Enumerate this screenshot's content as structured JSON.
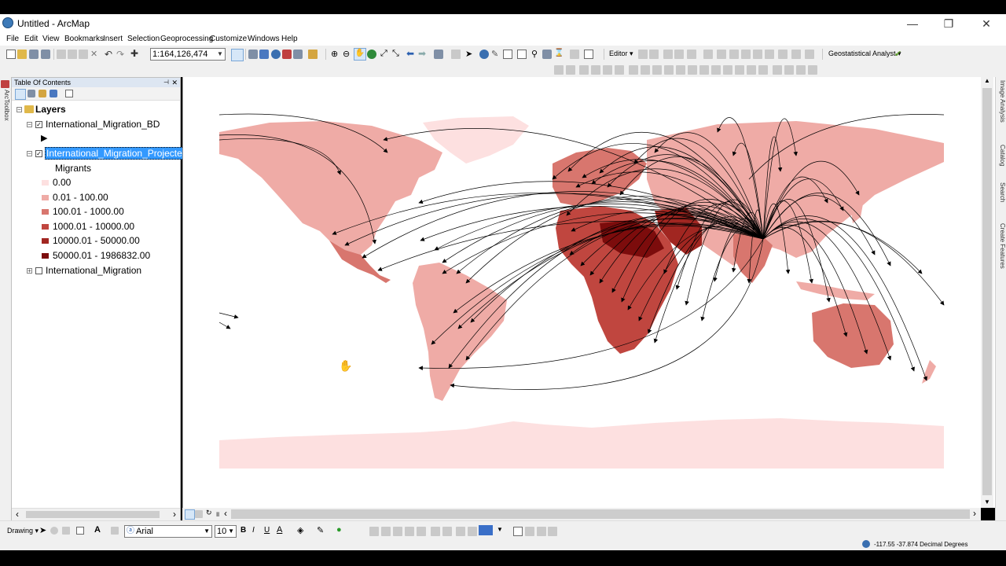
{
  "window": {
    "title": "Untitled - ArcMap",
    "controls": [
      "—",
      "❐",
      "✕"
    ]
  },
  "menu": [
    "File",
    "Edit",
    "View",
    "Bookmarks",
    "Insert",
    "Selection",
    "Geoprocessing",
    "Customize",
    "Windows",
    "Help"
  ],
  "toolbar": {
    "scale_value": "1:164,126,474",
    "editor_label": "Editor ▾",
    "geostat_label": "Geostatistical Analyst ▾"
  },
  "toc": {
    "header": "Table Of Contents",
    "root_label": "Layers",
    "layers": [
      {
        "name": "International_Migration_BD",
        "checked": true,
        "expanded": true
      },
      {
        "name": "International_Migration_Projecte",
        "checked": true,
        "expanded": true,
        "selected": true
      },
      {
        "name": "International_Migration",
        "checked": false,
        "expanded": false
      }
    ],
    "legend_title": "Migrants",
    "legend": [
      {
        "label": "0.00",
        "color": "#fde0e0"
      },
      {
        "label": "0.01 - 100.00",
        "color": "#efaba6"
      },
      {
        "label": "100.01 - 1000.00",
        "color": "#d8766e"
      },
      {
        "label": "1000.01 - 10000.00",
        "color": "#c0463f"
      },
      {
        "label": "10000.01 - 50000.00",
        "color": "#a12621"
      },
      {
        "label": "50000.01 - 1986832.00",
        "color": "#7c0c0c"
      }
    ]
  },
  "right_tabs": [
    "Image Analysis",
    "Catalog",
    "Search",
    "Create Features"
  ],
  "left_tabs": [
    "ArcToolbox"
  ],
  "drawing_toolbar": {
    "label": "Drawing ▾",
    "font_name": "Arial",
    "font_size": "10",
    "styles": [
      "B",
      "I",
      "U"
    ]
  },
  "status": {
    "coordinates": "-117.55  -37.874 Decimal Degrees"
  },
  "colors": {
    "selection": "#3399ff",
    "ocean": "#ffffff",
    "land_light": "#fde0e0"
  }
}
